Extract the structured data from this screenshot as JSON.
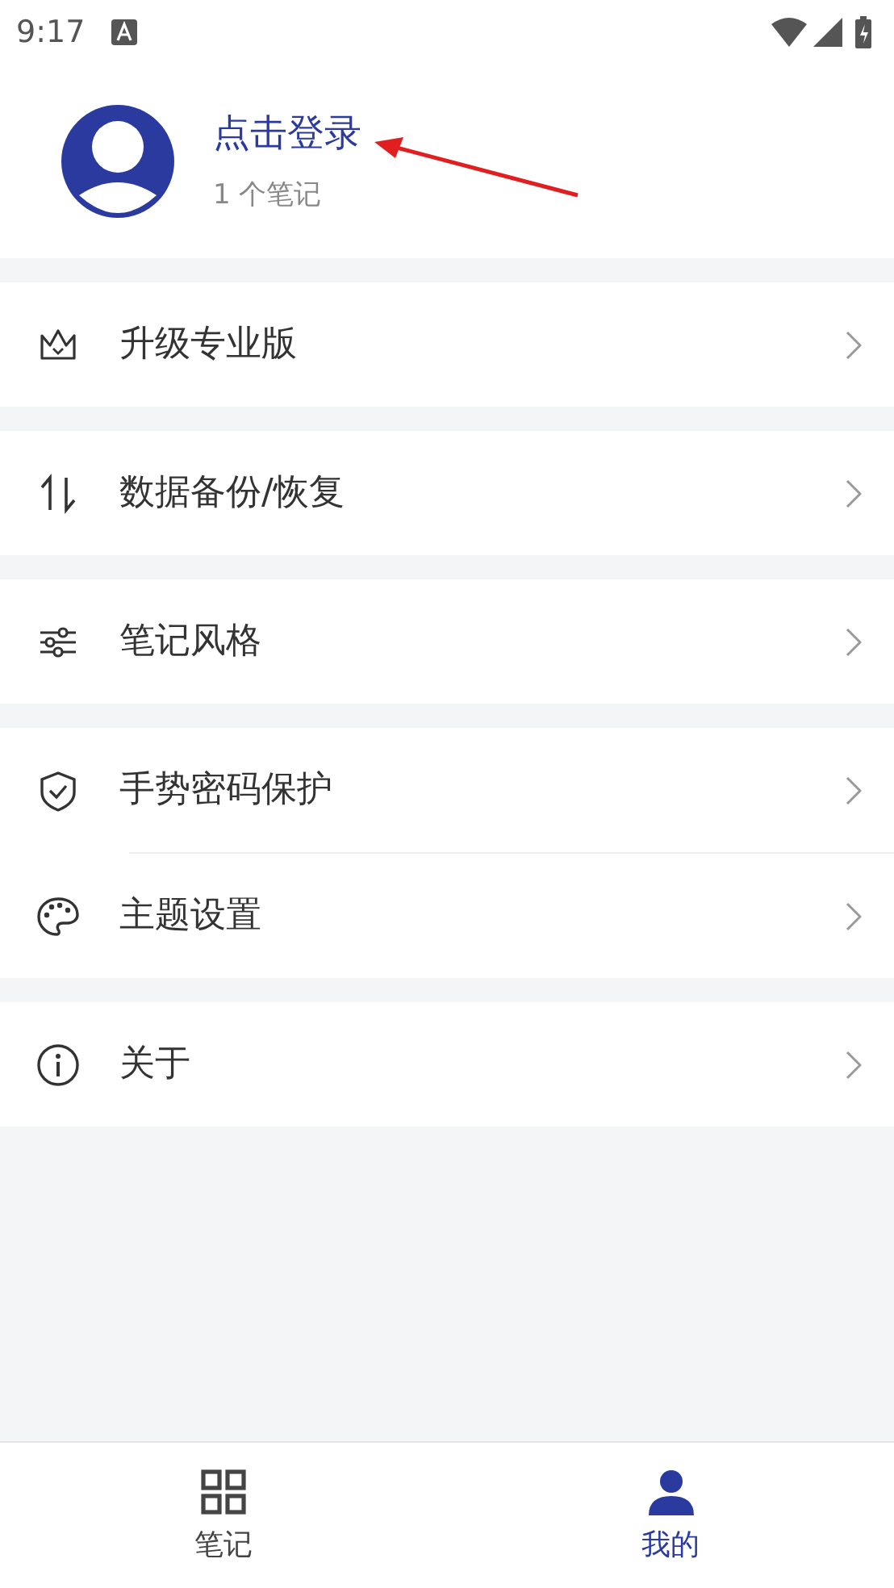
{
  "status_bar": {
    "time": "9:17"
  },
  "profile": {
    "title": "点击登录",
    "subtitle": "1 个笔记"
  },
  "menu_groups": [
    [
      {
        "kind": "crown",
        "label": "升级专业版"
      }
    ],
    [
      {
        "kind": "swap",
        "label": "数据备份/恢复"
      }
    ],
    [
      {
        "kind": "sliders",
        "label": "笔记风格"
      }
    ],
    [
      {
        "kind": "shield",
        "label": "手势密码保护"
      },
      {
        "kind": "palette",
        "label": "主题设置"
      }
    ],
    [
      {
        "kind": "info",
        "label": "关于"
      }
    ]
  ],
  "tabs": [
    {
      "kind": "grid",
      "label": "笔记",
      "selected": false
    },
    {
      "kind": "person",
      "label": "我的",
      "selected": true
    }
  ]
}
